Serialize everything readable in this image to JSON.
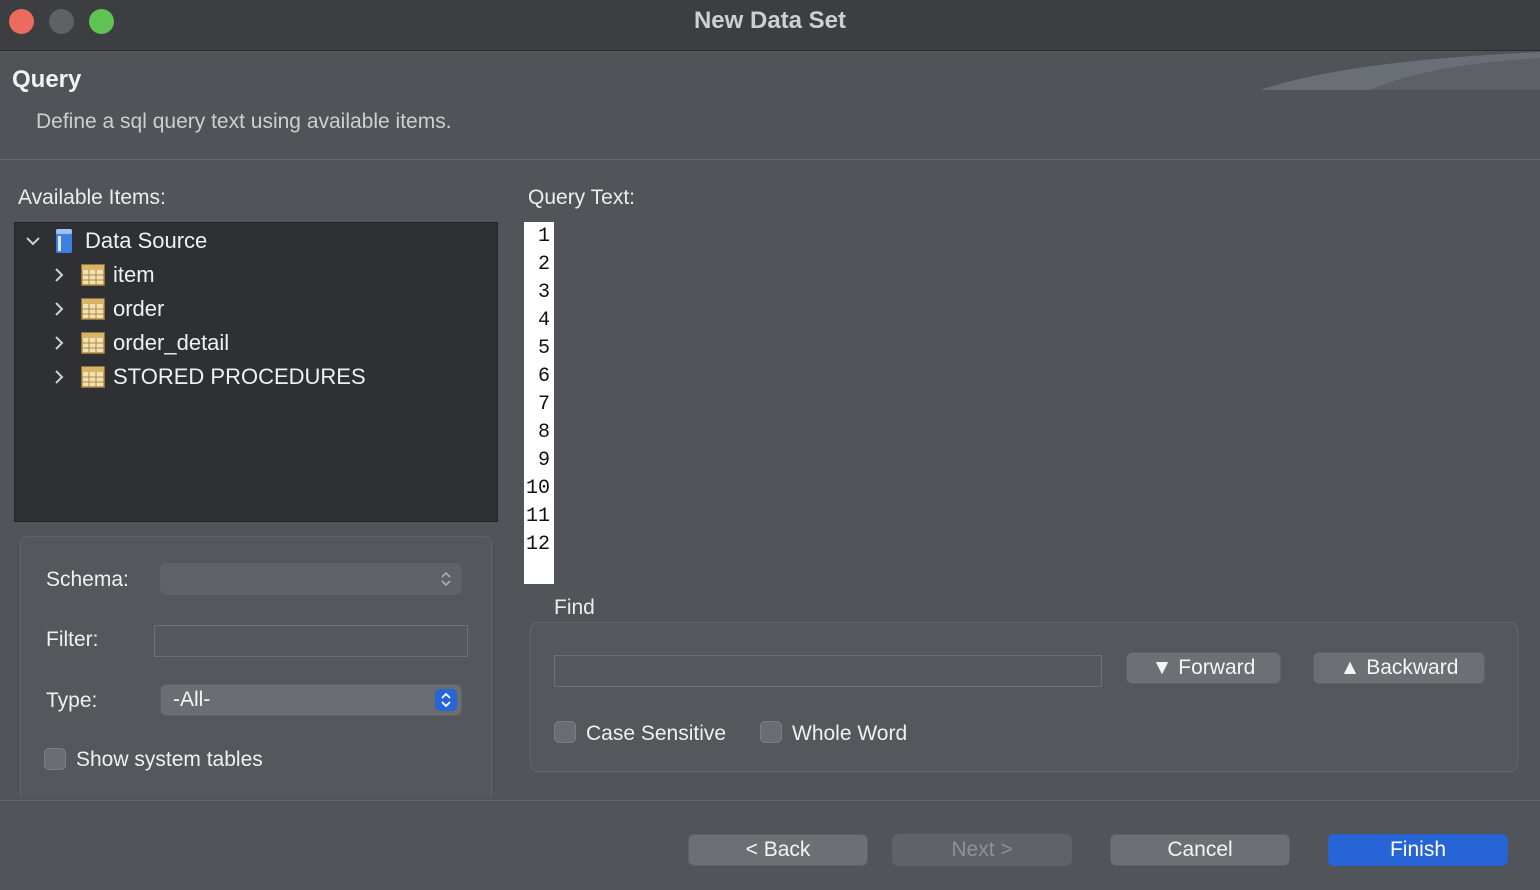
{
  "window": {
    "title": "New Data Set"
  },
  "header": {
    "title": "Query",
    "description": "Define a sql query text using available items."
  },
  "available_items": {
    "label": "Available Items:",
    "tree": [
      {
        "label": "Data Source",
        "icon": "database-icon",
        "expanded": true
      },
      {
        "label": "item",
        "icon": "table-icon"
      },
      {
        "label": "order",
        "icon": "table-icon"
      },
      {
        "label": "order_detail",
        "icon": "table-icon"
      },
      {
        "label": "STORED PROCEDURES",
        "icon": "table-icon"
      }
    ]
  },
  "filters": {
    "schema_label": "Schema:",
    "schema_value": "",
    "filter_label": "Filter:",
    "filter_value": "",
    "type_label": "Type:",
    "type_value": "-All-",
    "show_system_tables": "Show system tables"
  },
  "query": {
    "label": "Query Text:",
    "line_numbers": [
      "1",
      "2",
      "3",
      "4",
      "5",
      "6",
      "7",
      "8",
      "9",
      "10",
      "11",
      "12"
    ]
  },
  "find": {
    "label": "Find",
    "input_value": "",
    "forward": "▼ Forward",
    "backward": "▲ Backward",
    "case_sensitive": "Case Sensitive",
    "whole_word": "Whole Word"
  },
  "footer": {
    "back": "< Back",
    "next": "Next >",
    "cancel": "Cancel",
    "finish": "Finish"
  },
  "colors": {
    "keyword": "#b4116d",
    "accent": "#2764d6"
  }
}
